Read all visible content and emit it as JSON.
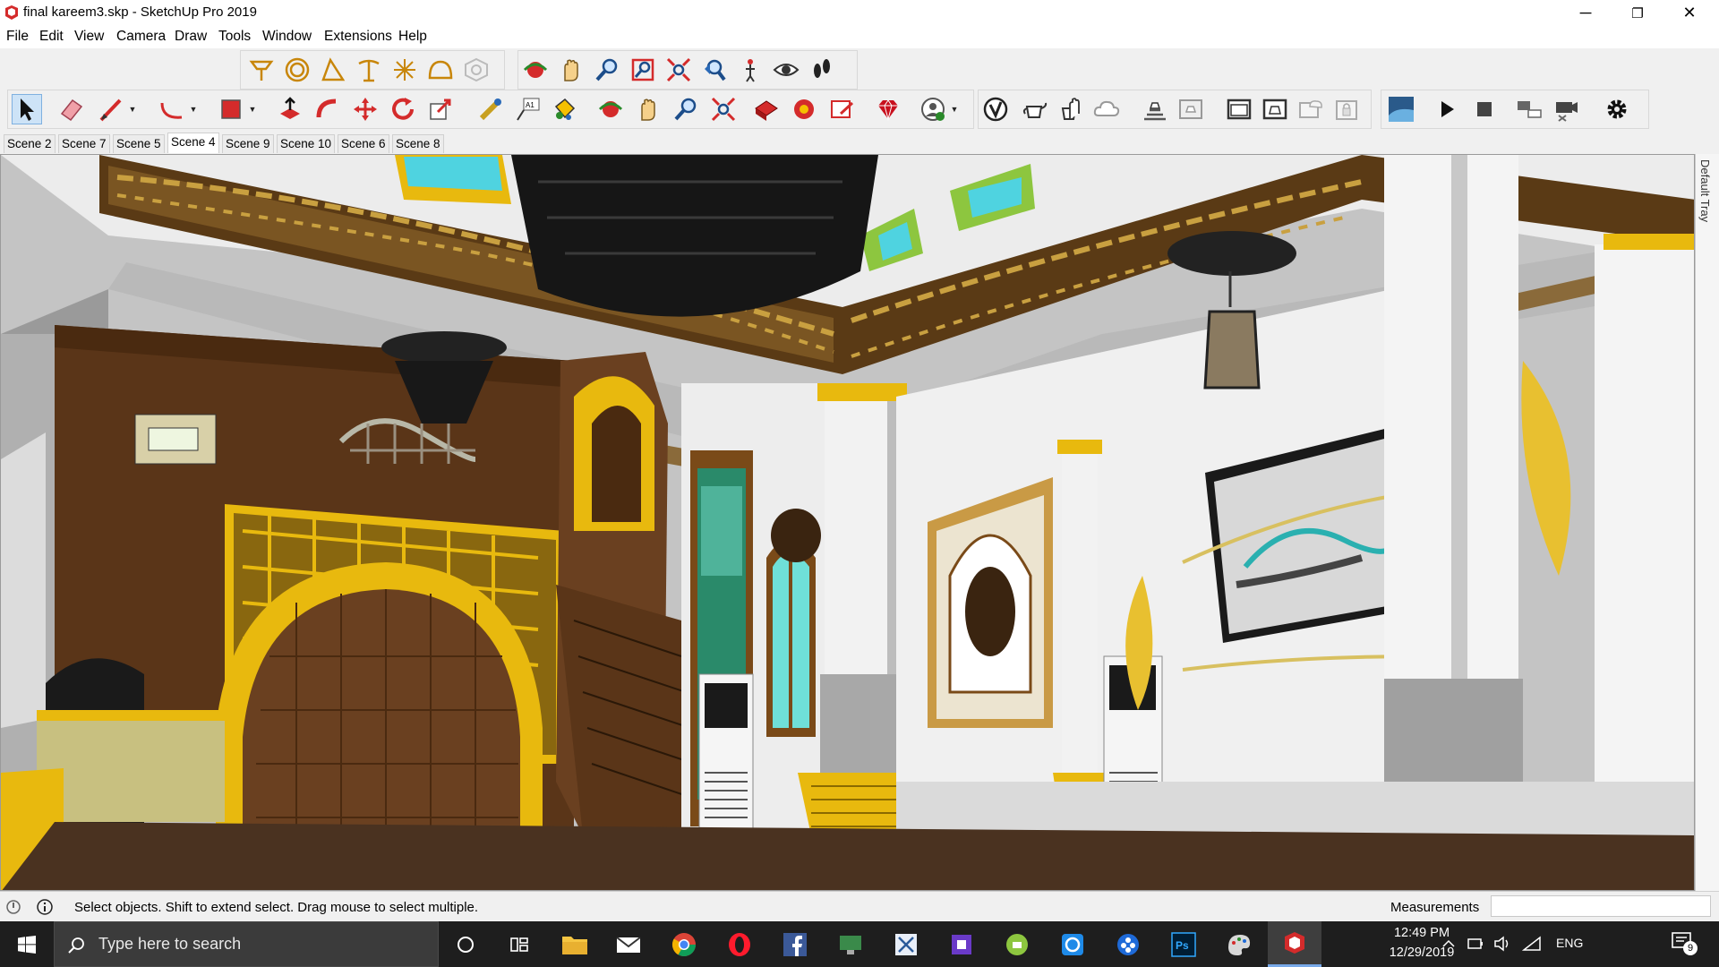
{
  "window": {
    "title": "final kareem3.skp - SketchUp Pro 2019",
    "minimize_label": "─",
    "maximize_label": "❐",
    "close_label": "✕"
  },
  "menu": [
    "File",
    "Edit",
    "View",
    "Camera",
    "Draw",
    "Tools",
    "Window",
    "Extensions",
    "Help"
  ],
  "scene_tabs": [
    "Scene 2",
    "Scene 7",
    "Scene 5",
    "Scene 4",
    "Scene 9",
    "Scene 10",
    "Scene 6",
    "Scene 8"
  ],
  "active_scene": "Scene 4",
  "tray_label": "Default Tray",
  "status": {
    "message": "Select objects. Shift to extend select. Drag mouse to select multiple.",
    "measurements_label": "Measurements",
    "measurements_value": ""
  },
  "taskbar": {
    "search_placeholder": "Type here to search",
    "language": "ENG",
    "time": "12:49 PM",
    "date": "12/29/2019",
    "notification_count": "9"
  },
  "icons": {
    "toolbar_top": [
      "3d-text-icon",
      "circle-icon",
      "protractor-icon",
      "tape-measure-icon",
      "axes-icon",
      "section-dome-icon",
      "component-cube-icon",
      "orbit-icon",
      "pan-icon",
      "zoom-icon",
      "zoom-window-icon",
      "zoom-extents-icon",
      "previous-view-icon",
      "position-camera-icon",
      "look-around-icon",
      "walk-icon"
    ],
    "toolbar_main": [
      "select-icon",
      "eraser-icon",
      "line-icon",
      "arc-icon",
      "rectangle-icon",
      "push-pull-icon",
      "follow-me-icon",
      "move-icon",
      "rotate-icon",
      "scale-icon",
      "tape-icon",
      "text-icon",
      "paint-bucket-icon",
      "orbit-icon",
      "pan-icon",
      "zoom-icon",
      "zoom-extents-icon",
      "warehouse-icon",
      "extension-warehouse-icon",
      "layout-icon",
      "ruby-icon",
      "account-icon",
      "validate-icon",
      "teapot-icon",
      "hand-icon",
      "cloud-icon",
      "render-settings-icon",
      "render-region-icon",
      "frame-icon",
      "render-icon",
      "cloud-render-icon",
      "lock-icon",
      "lumion-icon",
      "play-icon",
      "stop-icon",
      "livesync-icon",
      "camera-icon",
      "gear-icon"
    ]
  },
  "colors": {
    "title_bg": "#ffffff",
    "toolbar_bg": "#f0f0f0",
    "taskbar_bg": "#1e1e1e",
    "accent_red": "#d42b2b",
    "gold": "#e8b90e",
    "wood": "#5a3518"
  }
}
